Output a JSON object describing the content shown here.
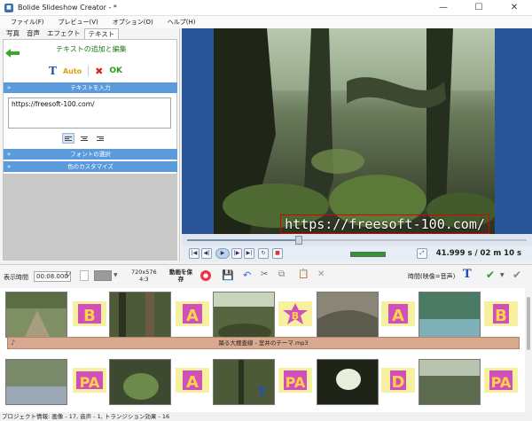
{
  "window": {
    "title": "Bolide Slideshow Creator - *",
    "app_icon": "app-icon"
  },
  "menu": [
    "ファイル(F)",
    "プレビュー(V)",
    "オプション(O)",
    "ヘルプ(H)"
  ],
  "tabs": [
    {
      "label": "写真"
    },
    {
      "label": "音声"
    },
    {
      "label": "エフェクト"
    },
    {
      "label": "テキスト"
    }
  ],
  "text_panel": {
    "title": "テキストの追加と編集",
    "auto_label": "Auto",
    "ok_label": "OK",
    "section_input": "テキストを入力",
    "text_value": "https://freesoft-100.com/",
    "section_font": "フォントの選択",
    "section_color": "色のカスタマイズ"
  },
  "preview": {
    "overlay_text": "https://freesoft-100.com/",
    "time_current": "41.999 s",
    "time_total": "/ 02 m 10 s",
    "playback_progress": 0.33
  },
  "timeline_toolbar": {
    "duration_label": "表示時間",
    "duration_value": "00:08.000",
    "resolution": "720x576",
    "aspect": "4:3",
    "save_video_label": "動画を保存",
    "time_mode_label": "時間(映像=音声)"
  },
  "audio_track": {
    "label": "踊る大捜査線 - 室井のテーマ.mp3"
  },
  "status": {
    "text": "プロジェクト情報: 画像 - 17, 音声 - 1, トランジション効果 - 16"
  },
  "colors": {
    "accent_blue": "#5b9bdc",
    "preview_bg": "#2a5598",
    "audio_bar": "#d8a98f"
  }
}
